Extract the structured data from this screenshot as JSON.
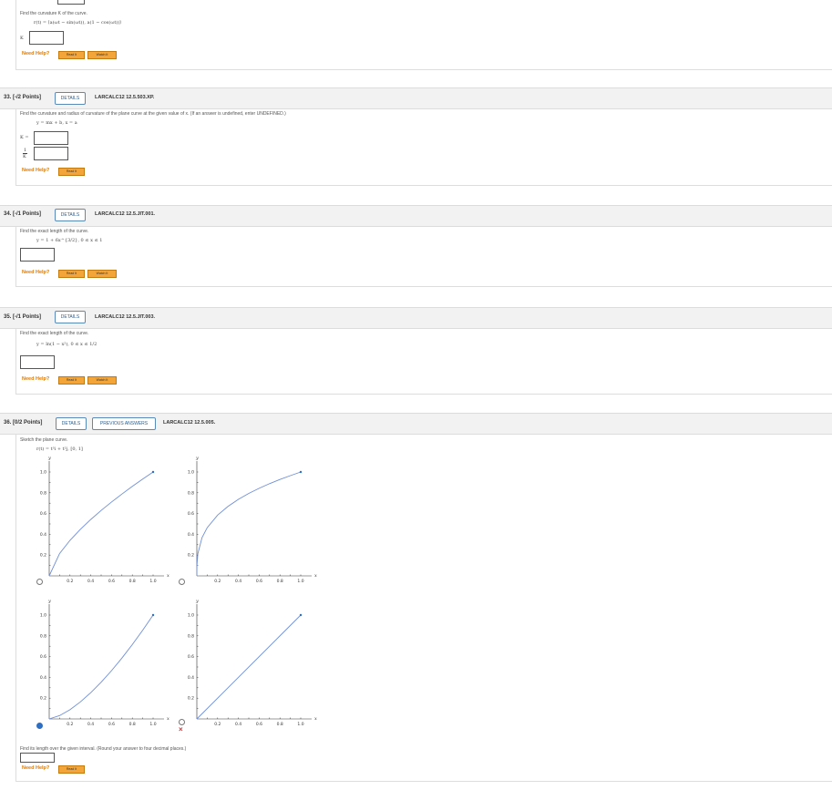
{
  "q31": {
    "prompt": "Find the curvature K of the curve.",
    "equation": "r(t) = ⟨a(ωt − sin(ωt)), a(1 − cos(ωt))⟩",
    "input_label": "K",
    "help": "Need Help?",
    "read": "Read It",
    "watch": "Watch It"
  },
  "q33": {
    "number": "33.  [-/2 Points]",
    "details": "DETAILS",
    "code": "LARCALC12 12.5.503.XP.",
    "prompt": "Find the curvature and radius of curvature of the plane curve at the given value of x. (If an answer is undefined, enter UNDEFINED.)",
    "equation": "y = mx + b,  x = a",
    "label_k": "K =",
    "label_r_num": "1",
    "label_r_den": "K",
    "help": "Need Help?",
    "read": "Read It"
  },
  "q34": {
    "number": "34.  [-/1 Points]",
    "details": "DETAILS",
    "code": "LARCALC12 12.5.JIT.001.",
    "prompt": "Find the exact length of the curve.",
    "equation": "y = 1 + 6x^{3/2},   0 ≤ x ≤ 1",
    "help": "Need Help?",
    "read": "Read It",
    "watch": "Watch It"
  },
  "q35": {
    "number": "35.  [-/1 Points]",
    "details": "DETAILS",
    "code": "LARCALC12 12.5.JIT.003.",
    "prompt": "Find the exact length of the curve.",
    "equation": "y = ln(1 − x²),   0 ≤ x ≤ 1/2",
    "help": "Need Help?",
    "read": "Read It",
    "watch": "Watch It"
  },
  "q36": {
    "number": "36.  [0/2 Points]",
    "details": "DETAILS",
    "previous": "PREVIOUS ANSWERS",
    "code": "LARCALC12 12.5.005.",
    "prompt": "Sketch the plane curve.",
    "equation": "r(t) = t³i + t²j,   [0, 1]",
    "prompt2": "Find its length over the given interval. (Round your answer to four decimal places.)",
    "help": "Need Help?",
    "read": "Read It",
    "wrong_mark": "×"
  },
  "chart_data": [
    {
      "type": "line",
      "curve": "y = x^(2/3)",
      "x": [
        0,
        0.1,
        0.2,
        0.3,
        0.4,
        0.5,
        0.6,
        0.7,
        0.8,
        0.9,
        1.0
      ],
      "y": [
        0,
        0.215,
        0.342,
        0.448,
        0.543,
        0.63,
        0.711,
        0.788,
        0.862,
        0.932,
        1.0
      ],
      "xlabel": "x",
      "ylabel": "y",
      "xlim": [
        0,
        1
      ],
      "ylim": [
        0,
        1
      ],
      "xticks": [
        "0.2",
        "0.4",
        "0.6",
        "0.8",
        "1.0"
      ],
      "yticks": [
        "0.2",
        "0.4",
        "0.6",
        "0.8",
        "1.0"
      ],
      "selected": false
    },
    {
      "type": "line",
      "curve": "y = x^(1/3)",
      "x": [
        0,
        0.001,
        0.01,
        0.05,
        0.1,
        0.2,
        0.3,
        0.4,
        0.5,
        0.6,
        0.7,
        0.8,
        0.9,
        1.0
      ],
      "y": [
        0,
        0.1,
        0.215,
        0.368,
        0.464,
        0.585,
        0.669,
        0.737,
        0.794,
        0.843,
        0.888,
        0.928,
        0.965,
        1.0
      ],
      "xlabel": "x",
      "ylabel": "y",
      "xlim": [
        0,
        1
      ],
      "ylim": [
        0,
        1
      ],
      "xticks": [
        "0.2",
        "0.4",
        "0.6",
        "0.8",
        "1.0"
      ],
      "yticks": [
        "0.2",
        "0.4",
        "0.6",
        "0.8",
        "1.0"
      ],
      "selected": false
    },
    {
      "type": "line",
      "curve": "y = x^(3/2)",
      "x": [
        0,
        0.1,
        0.2,
        0.3,
        0.4,
        0.5,
        0.6,
        0.7,
        0.8,
        0.9,
        1.0
      ],
      "y": [
        0,
        0.032,
        0.089,
        0.164,
        0.253,
        0.354,
        0.465,
        0.586,
        0.716,
        0.854,
        1.0
      ],
      "xlabel": "x",
      "ylabel": "y",
      "xlim": [
        0,
        1
      ],
      "ylim": [
        0,
        1
      ],
      "xticks": [
        "0.2",
        "0.4",
        "0.6",
        "0.8",
        "1.0"
      ],
      "yticks": [
        "0.2",
        "0.4",
        "0.6",
        "0.8",
        "1.0"
      ],
      "selected": true
    },
    {
      "type": "line",
      "curve": "y = x",
      "x": [
        0,
        1
      ],
      "y": [
        0,
        1
      ],
      "xlabel": "x",
      "ylabel": "y",
      "xlim": [
        0,
        1
      ],
      "ylim": [
        0,
        1
      ],
      "xticks": [
        "0.2",
        "0.4",
        "0.6",
        "0.8",
        "1.0"
      ],
      "yticks": [
        "0.2",
        "0.4",
        "0.6",
        "0.8",
        "1.0"
      ],
      "selected": false
    }
  ],
  "colors": {
    "curve": "#6f8fd8",
    "accent": "#f3a53a",
    "link": "#2b5d8c"
  }
}
